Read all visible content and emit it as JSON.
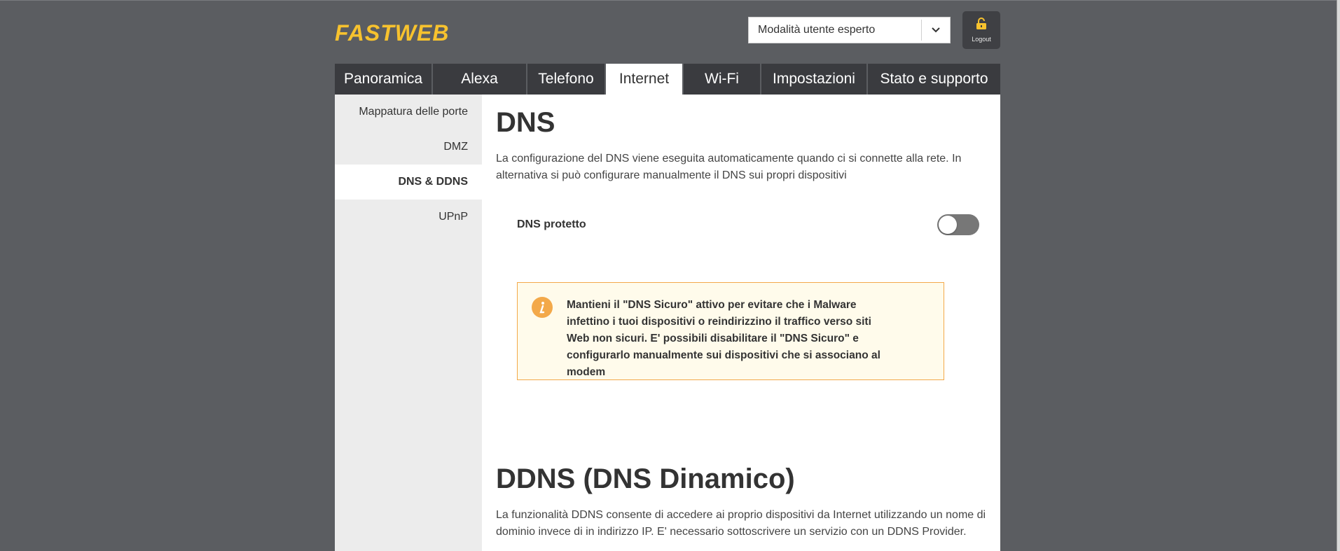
{
  "brand": {
    "logo_text": "FASTWEB",
    "accent_color": "#f7c22e"
  },
  "header": {
    "mode_select": {
      "selected": "Modalità utente esperto",
      "icon": "chevron-down-icon"
    },
    "logout": {
      "label": "Logout",
      "icon": "unlock-icon"
    }
  },
  "tabs": [
    {
      "label": "Panoramica",
      "active": false
    },
    {
      "label": "Alexa",
      "active": false
    },
    {
      "label": "Telefono",
      "active": false
    },
    {
      "label": "Internet",
      "active": true
    },
    {
      "label": "Wi-Fi",
      "active": false
    },
    {
      "label": "Impostazioni",
      "active": false
    },
    {
      "label": "Stato e supporto",
      "active": false
    }
  ],
  "sidebar": {
    "items": [
      {
        "label": "Mappatura delle porte",
        "active": false
      },
      {
        "label": "DMZ",
        "active": false
      },
      {
        "label": "DNS & DDNS",
        "active": true
      },
      {
        "label": "UPnP",
        "active": false
      }
    ]
  },
  "dns": {
    "title": "DNS",
    "description": "La configurazione del DNS viene eseguita automaticamente quando ci si connette alla rete. In alternativa si può configurare manualmente il DNS sui propri dispositivi",
    "toggle_label": "DNS protetto",
    "toggle_on": false,
    "info_icon": "info-icon",
    "info_text": "Mantieni il \"DNS Sicuro\" attivo per evitare che i Malware infettino i tuoi dispositivi o reindirizzino il traffico verso siti Web non sicuri. E' possibili disabilitare il \"DNS Sicuro\" e configurarlo manualmente sui dispositivi che si associano al modem"
  },
  "ddns": {
    "title": "DDNS (DNS Dinamico)",
    "description": "La funzionalità DDNS consente di accedere ai proprio dispositivi da Internet utilizzando un nome di dominio invece di in indirizzo IP. E' necessario sottoscrivere un servizio con un DDNS Provider."
  }
}
